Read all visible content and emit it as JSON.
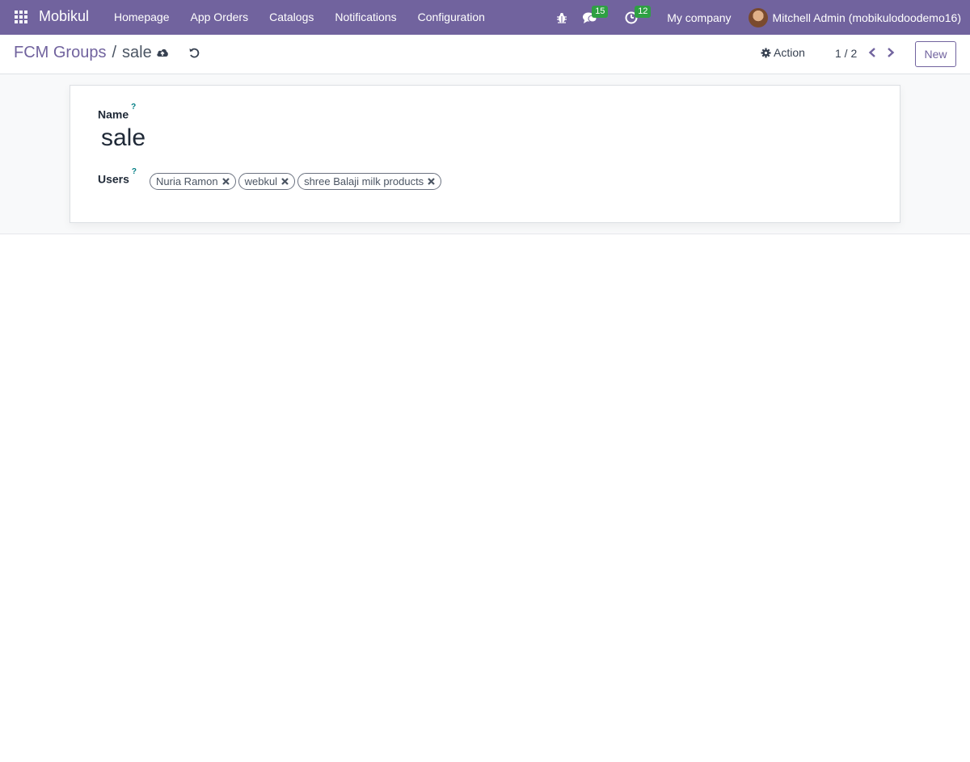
{
  "navbar": {
    "brand": "Mobikul",
    "menu": [
      "Homepage",
      "App Orders",
      "Catalogs",
      "Notifications",
      "Configuration"
    ],
    "messages_count": "15",
    "activities_count": "12",
    "company": "My company",
    "user": "Mitchell Admin (mobikulodoodemo16)"
  },
  "control_panel": {
    "breadcrumb_parent": "FCM Groups",
    "breadcrumb_separator": "/",
    "breadcrumb_current": "sale",
    "action_label": "Action",
    "pager": "1 / 2",
    "new_label": "New"
  },
  "form": {
    "name_label": "Name",
    "help_mark": "?",
    "name_value": "sale",
    "users_label": "Users",
    "users": [
      "Nuria Ramon",
      "webkul",
      "shree Balaji milk products"
    ]
  },
  "colors": {
    "navbar": "#71639e",
    "accent": "#71639e",
    "badge": "#2ea043",
    "help": "#017e84"
  }
}
